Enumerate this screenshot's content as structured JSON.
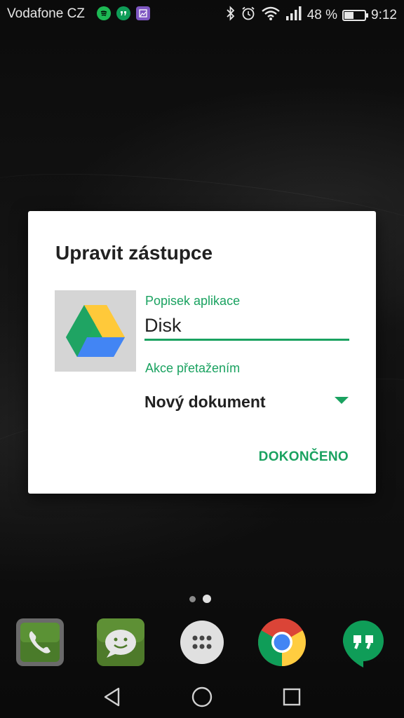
{
  "status_bar": {
    "carrier": "Vodafone CZ",
    "notification_icons": [
      "spotify-icon",
      "hangouts-icon",
      "gallery-icon"
    ],
    "system_icons": [
      "bluetooth-icon",
      "alarm-icon",
      "wifi-icon",
      "signal-icon"
    ],
    "battery": "48 %",
    "battery_level": 0.48,
    "time": "9:12"
  },
  "dialog": {
    "title": "Upravit zástupce",
    "app_icon": "google-drive-icon",
    "name_label": "Popisek aplikace",
    "name_value": "Disk",
    "action_label": "Akce přetažením",
    "action_value": "Nový dokument",
    "done_label": "DOKONČENO",
    "accent_color": "#1aa260"
  },
  "home": {
    "page_count": 2,
    "active_page": 2,
    "dock_apps": [
      "phone-icon",
      "messages-icon",
      "app-drawer-icon",
      "chrome-icon",
      "hangouts-icon"
    ]
  },
  "nav_bar": {
    "buttons": [
      "back-icon",
      "home-icon",
      "recents-icon"
    ]
  }
}
